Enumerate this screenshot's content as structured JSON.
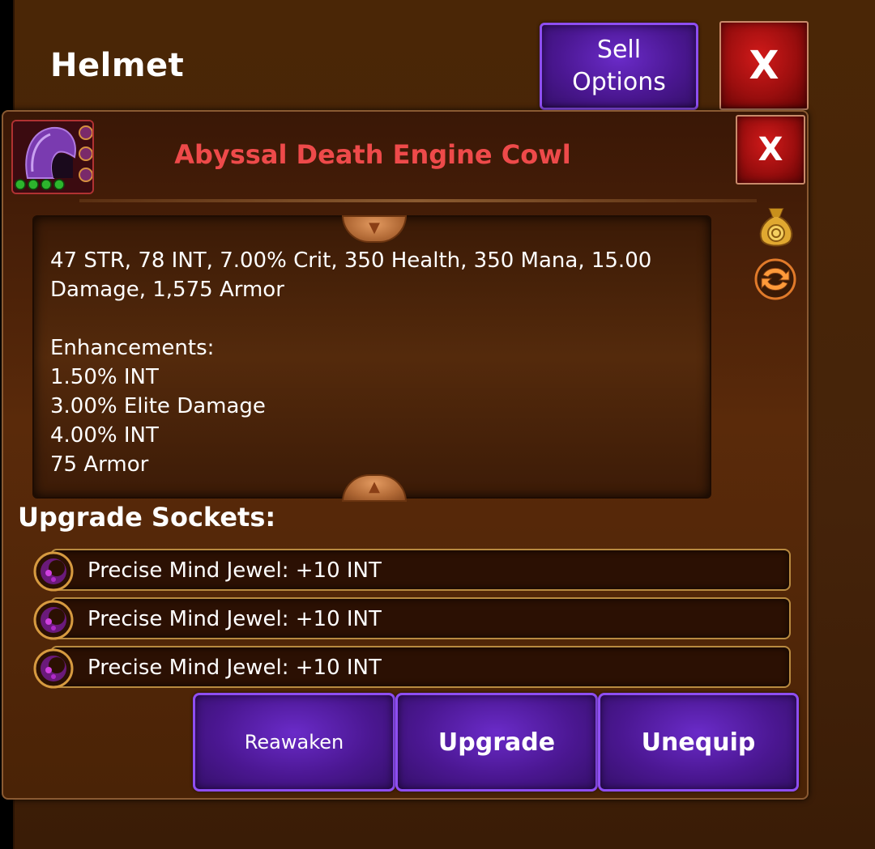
{
  "header": {
    "title": "Helmet",
    "sell_button": {
      "line1": "Sell",
      "line2": "Options"
    },
    "close_label": "X"
  },
  "item": {
    "name": "Abyssal Death Engine Cowl",
    "name_color": "#ee4a4a",
    "close_label": "X",
    "stats_line1": "47 STR, 78 INT, 7.00% Crit, 350 Health, 350 Mana, 15.00",
    "stats_line2": "Damage, 1,575 Armor",
    "enhancements_title": "Enhancements:",
    "enhancements": [
      "1.50% INT",
      "3.00% Elite Damage",
      "4.00% INT",
      "75 Armor"
    ]
  },
  "sockets": {
    "title": "Upgrade Sockets:",
    "items": [
      {
        "label": "Precise Mind Jewel: +10 INT"
      },
      {
        "label": "Precise Mind Jewel: +10 INT"
      },
      {
        "label": "Precise Mind Jewel: +10 INT"
      }
    ]
  },
  "actions": {
    "reawaken": "Reawaken",
    "upgrade": "Upgrade",
    "unequip": "Unequip"
  },
  "icons": {
    "item": "hooded-cowl-icon",
    "side_top": "gold-bag-icon",
    "side_bottom": "swap-arrows-icon",
    "socket": "purple-jewel-icon"
  },
  "colors": {
    "button_purple": "#4b1792",
    "button_red": "#9a0e0e",
    "panel_brown": "#4a2606"
  }
}
